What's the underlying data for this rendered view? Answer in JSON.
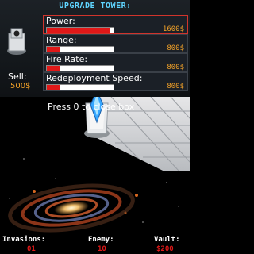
{
  "panel": {
    "title": "UPGRADE TOWER:",
    "sell_label": "Sell:",
    "sell_price": "500$"
  },
  "stats": [
    {
      "label": "Power:",
      "price": "1600$",
      "fill": 0.95,
      "selected": true
    },
    {
      "label": "Range:",
      "price": "800$",
      "fill": 0.2,
      "selected": false
    },
    {
      "label": "Fire Rate:",
      "price": "800$",
      "fill": 0.2,
      "selected": false
    },
    {
      "label": "Redeployment Speed:",
      "price": "800$",
      "fill": 0.2,
      "selected": false
    }
  ],
  "prompt": "Press 0 to close box",
  "hud": {
    "invasions_label": "Invasions:",
    "invasions_value": "01",
    "enemy_label": "Enemy:",
    "enemy_value": "10",
    "vault_label": "Vault:",
    "vault_value": "$200"
  },
  "colors": {
    "accent": "#5fd4ff",
    "price": "#f0a028",
    "bar_fill": "#e01818",
    "selected_border": "#d0342c"
  },
  "icons": {
    "tower": "tower-icon",
    "galaxy": "galaxy-icon"
  }
}
